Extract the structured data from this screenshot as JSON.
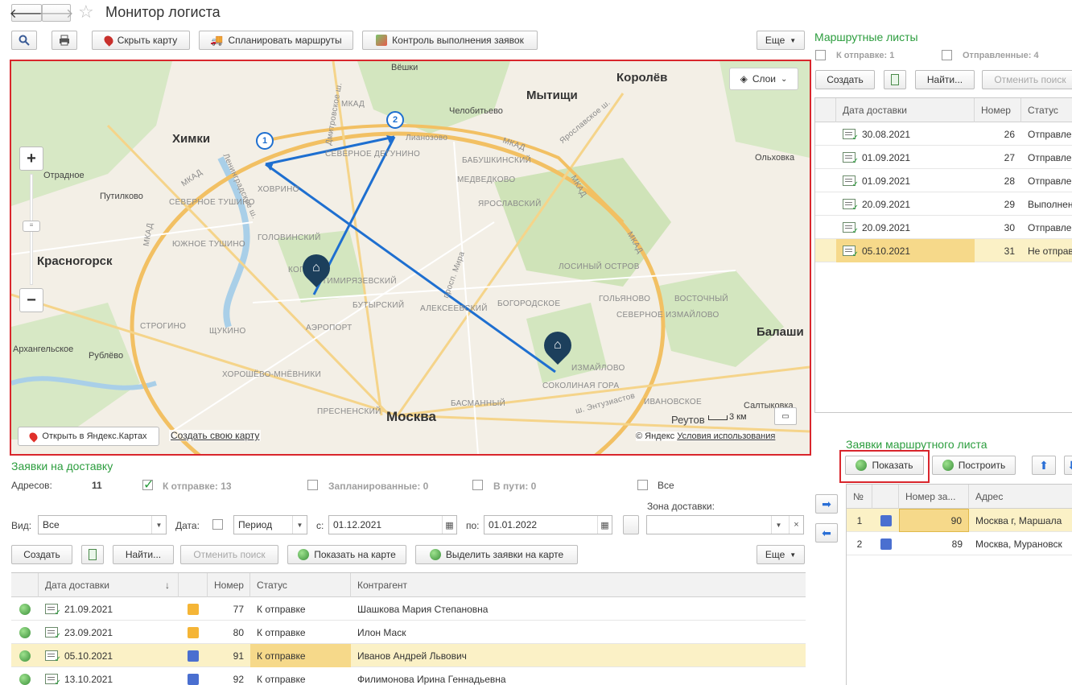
{
  "window": {
    "title": "Монитор логиста"
  },
  "toolbar": {
    "hide_map": "Скрыть карту",
    "plan_routes": "Спланировать маршруты",
    "control_orders": "Контроль выполнения заявок",
    "more": "Еще"
  },
  "map": {
    "layers": "Слои",
    "open_yandex": "Открыть в Яндекс.Картах",
    "create_map": "Создать свою карту",
    "copyright": "© Яндекс",
    "terms": "Условия использования",
    "scale": "3 км",
    "labels": [
      "Химки",
      "Мытищи",
      "Королёв",
      "Красногорск",
      "Москва",
      "Реутов",
      "Балаши",
      "Вёшки",
      "Челобитьево",
      "Отрадное",
      "Путилково",
      "Архангельское",
      "Рублёво",
      "Салтыковка",
      "Ольховка",
      "МКАД",
      "МКАД",
      "МКАД",
      "МКАД",
      "МКАД",
      "МКАД",
      "Ленинградское ш.",
      "Дмитровское ш.",
      "Ярославское ш.",
      "просп. Мира",
      "ш. Энтузиастов",
      "Лианозово"
    ],
    "districts": [
      "СЕВЕРНОЕ ТУШИНО",
      "ЮЖНОЕ ТУШИНО",
      "ХОВРИНО",
      "ГОЛОВИНСКИЙ",
      "КОПТЕВО",
      "ТИМИРЯЗЕВСКИЙ",
      "БУТЫРСКИЙ",
      "АЭРОПОРТ",
      "ЩУКИНО",
      "СТРОГИНО",
      "ХОРОШЁВО-МНЁВНИКИ",
      "ПРЕСНЕНСКИЙ",
      "МЕДВЕДКОВО",
      "ЯРОСЛАВСКИЙ",
      "БАБУШКИНСКИЙ",
      "АЛЕКСЕЕВСКИЙ",
      "БОГОРОДСКОЕ",
      "ГОЛЬЯНОВО",
      "СЕВЕРНОЕ ИЗМАЙЛОВО",
      "ВОСТОЧНЫЙ",
      "ИЗМАЙЛОВО",
      "СОКОЛИНАЯ ГОРА",
      "БАСМАННЫЙ",
      "ИВАНОВСКОЕ",
      "СЕВЕРНОЕ ДЕГУНИНО",
      "ЛОСИНЫЙ ОСТРОВ"
    ],
    "markers": [
      "1",
      "2"
    ]
  },
  "orders": {
    "title": "Заявки на доставку",
    "addresses_label": "Адресов:",
    "addresses_count": "11",
    "to_send": "К отправке: 13",
    "planned": "Запланированные: 0",
    "in_transit": "В пути: 0",
    "all": "Все",
    "view_label": "Вид:",
    "view_value": "Все",
    "date_label": "Дата:",
    "period_value": "Период",
    "from_label": "с:",
    "from_value": "01.12.2021",
    "to_label": "по:",
    "to_value": "01.01.2022",
    "zone_label": "Зона доставки:",
    "create": "Создать",
    "find": "Найти...",
    "cancel_search": "Отменить поиск",
    "show_on_map": "Показать на карте",
    "highlight_on_map": "Выделить заявки на карте",
    "more": "Еще",
    "columns": [
      "Дата доставки",
      "Номер",
      "Статус",
      "Контрагент"
    ],
    "rows": [
      {
        "date": "21.09.2021",
        "number": "77",
        "status": "К отправке",
        "client": "Шашкова Мария Степановна",
        "box": "#f5b536"
      },
      {
        "date": "23.09.2021",
        "number": "80",
        "status": "К отправке",
        "client": "Илон Маск",
        "box": "#f5b536"
      },
      {
        "date": "05.10.2021",
        "number": "91",
        "status": "К отправке",
        "client": "Иванов Андрей Львович",
        "box": "#4a6fd0"
      },
      {
        "date": "13.10.2021",
        "number": "92",
        "status": "К отправке",
        "client": "Филимонова Ирина Геннадьевна",
        "box": "#4a6fd0"
      }
    ]
  },
  "route_sheets": {
    "title": "Маршрутные листы",
    "to_send": "К отправке: 1",
    "sent": "Отправленные: 4",
    "create": "Создать",
    "find": "Найти...",
    "cancel_search": "Отменить поиск",
    "columns": [
      "Дата доставки",
      "Номер",
      "Статус"
    ],
    "rows": [
      {
        "date": "30.08.2021",
        "number": "26",
        "status": "Отправле"
      },
      {
        "date": "01.09.2021",
        "number": "27",
        "status": "Отправле"
      },
      {
        "date": "01.09.2021",
        "number": "28",
        "status": "Отправле"
      },
      {
        "date": "20.09.2021",
        "number": "29",
        "status": "Выполнен"
      },
      {
        "date": "20.09.2021",
        "number": "30",
        "status": "Отправле"
      },
      {
        "date": "05.10.2021",
        "number": "31",
        "status": "Не отправ"
      }
    ]
  },
  "route_orders": {
    "title": "Заявки маршрутного листа",
    "show": "Показать",
    "build": "Построить",
    "columns": [
      "№",
      "Номер за...",
      "Адрес"
    ],
    "rows": [
      {
        "n": "1",
        "number": "90",
        "address": "Москва г, Маршала"
      },
      {
        "n": "2",
        "number": "89",
        "address": "Москва, Мурановск"
      }
    ]
  },
  "colors": {
    "accent_green": "#2c9d3e",
    "highlight_red": "#d9262c",
    "selected_row": "#fbf1c6",
    "route_blue": "#1e6fd0"
  }
}
